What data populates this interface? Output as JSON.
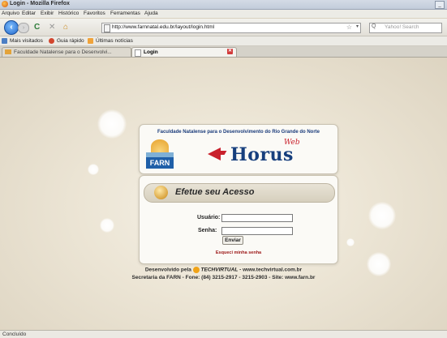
{
  "window": {
    "title": "Login - Mozilla Firefox",
    "min": "_"
  },
  "menu": [
    "Arquivo",
    "Editar",
    "Exibir",
    "Histórico",
    "Favoritos",
    "Ferramentas",
    "Ajuda"
  ],
  "nav": {
    "back": "‹",
    "forward": "›",
    "reload": "C",
    "stop": "✕",
    "home": "⌂",
    "url": "http://www.farnnatal.edu.br/layout/login.html",
    "star": "☆",
    "dropdown": "▾",
    "search_placeholder": "Yahoo! Search",
    "search_icon": "Q"
  },
  "bookmarks": [
    "Mais visitados",
    "Guia rápido",
    "Últimas notícias"
  ],
  "tabs": [
    {
      "label": "Faculdade Natalense para o Desenvolvi..."
    },
    {
      "label": "Login",
      "close": "✕"
    }
  ],
  "page": {
    "institution": "Faculdade Natalense para o Desenvolvimento do Rio Grande do Norte",
    "farn_logo": "FARN",
    "horus_logo": "Horus",
    "horus_web": "Web",
    "login_title": "Efetue seu Acesso",
    "user_label": "Usuário:",
    "password_label": "Senha:",
    "user_value": "",
    "password_value": "",
    "submit": "Enviar",
    "forgot": "Esqueci minha senha",
    "footer_dev_prefix": "Desenvolvido pela",
    "footer_brand": "TECHVIRTUAL",
    "footer_dev_suffix": " - www.techvirtual.com.br",
    "footer_contact": "Secretaria da FARN - Fone: (84) 3215-2917 - 3215-2903 - Site: www.farn.br"
  },
  "status": "Concluído",
  "colors": {
    "accent_blue": "#1f5fa8",
    "accent_red": "#c9202b",
    "forgot_red": "#9b1515"
  }
}
